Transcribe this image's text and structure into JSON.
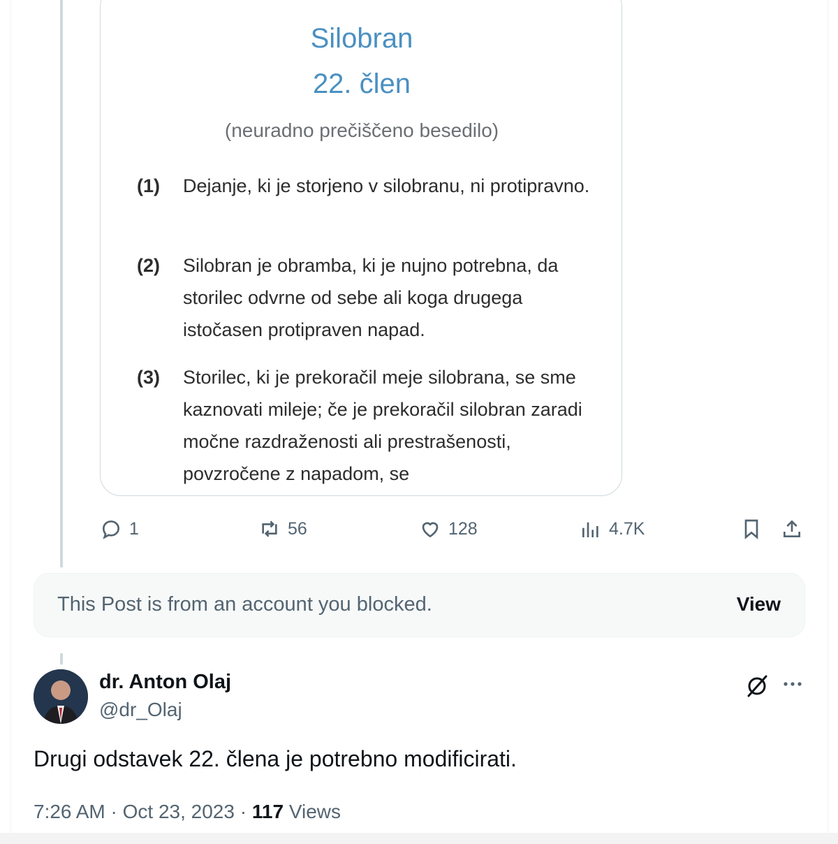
{
  "media_card": {
    "title": "Silobran",
    "subtitle": "22. člen",
    "note": "(neuradno prečiščeno besedilo)",
    "paragraphs": [
      {
        "num": "(1)",
        "text": "Dejanje, ki je storjeno v silobranu, ni protipravno."
      },
      {
        "num": "(2)",
        "text": "Silobran je obramba, ki je nujno potrebna, da storilec odvrne od sebe ali koga drugega istočasen protipraven napad."
      },
      {
        "num": "(3)",
        "text": "Storilec, ki je prekoračil meje silobrana, se sme kaznovati mileje; če je prekoračil silobran zaradi močne razdraženosti ali prestrašenosti, povzročene z napadom, se"
      }
    ]
  },
  "actions": {
    "reply_count": "1",
    "repost_count": "56",
    "like_count": "128",
    "views_count": "4.7K",
    "icons": [
      "reply-icon",
      "repost-icon",
      "like-icon",
      "views-icon",
      "bookmark-icon",
      "share-icon"
    ]
  },
  "blocked_notice": {
    "text": "This Post is from an account you blocked.",
    "view_label": "View"
  },
  "post": {
    "author_name": "dr. Anton Olaj",
    "author_handle": "@dr_Olaj",
    "text": "Drugi odstavek 22. člena je potrebno modificirati.",
    "time": "7:26 AM",
    "date": "Oct 23, 2023",
    "views_count": "117",
    "views_label": "Views"
  },
  "colors": {
    "doc_title": "#4a90c2",
    "secondary_text": "#536471",
    "primary_text": "#0f1419",
    "border": "#cfd9de"
  }
}
